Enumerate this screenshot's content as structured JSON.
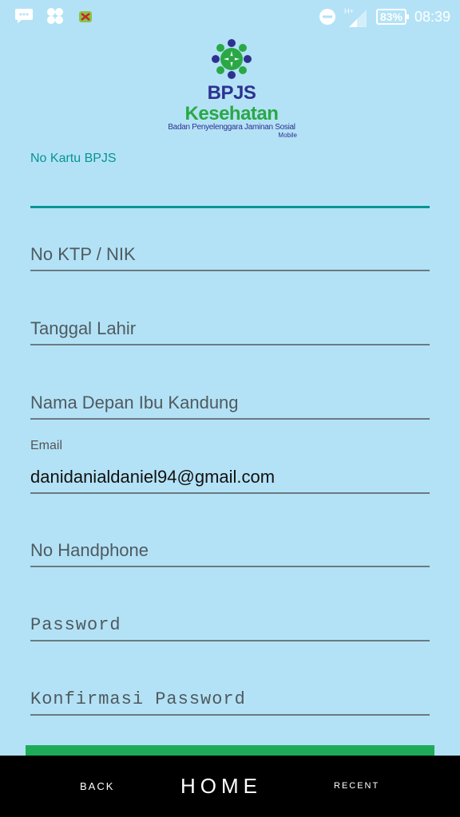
{
  "status_bar": {
    "battery": "83%",
    "time": "08:39",
    "network": "H+"
  },
  "logo": {
    "bpjs": "BPJS",
    "kesehatan": "Kesehatan",
    "subtitle": "Badan Penyelenggara Jaminan Sosial",
    "mobile": "Mobile"
  },
  "form": {
    "no_kartu_label": "No Kartu BPJS",
    "no_kartu_value": "",
    "no_ktp_placeholder": "No KTP / NIK",
    "tanggal_lahir_placeholder": "Tanggal Lahir",
    "nama_ibu_placeholder": "Nama Depan Ibu Kandung",
    "email_label": "Email",
    "email_value": "danidanialdaniel94@gmail.com",
    "no_hp_placeholder": "No Handphone",
    "password_placeholder": "Password",
    "konfirmasi_placeholder": "Konfirmasi Password"
  },
  "nav": {
    "back": "BACK",
    "home": "HOME",
    "recent": "RECENT"
  },
  "colors": {
    "background": "#b3e2f6",
    "accent": "#089494",
    "button": "#1eab58"
  }
}
